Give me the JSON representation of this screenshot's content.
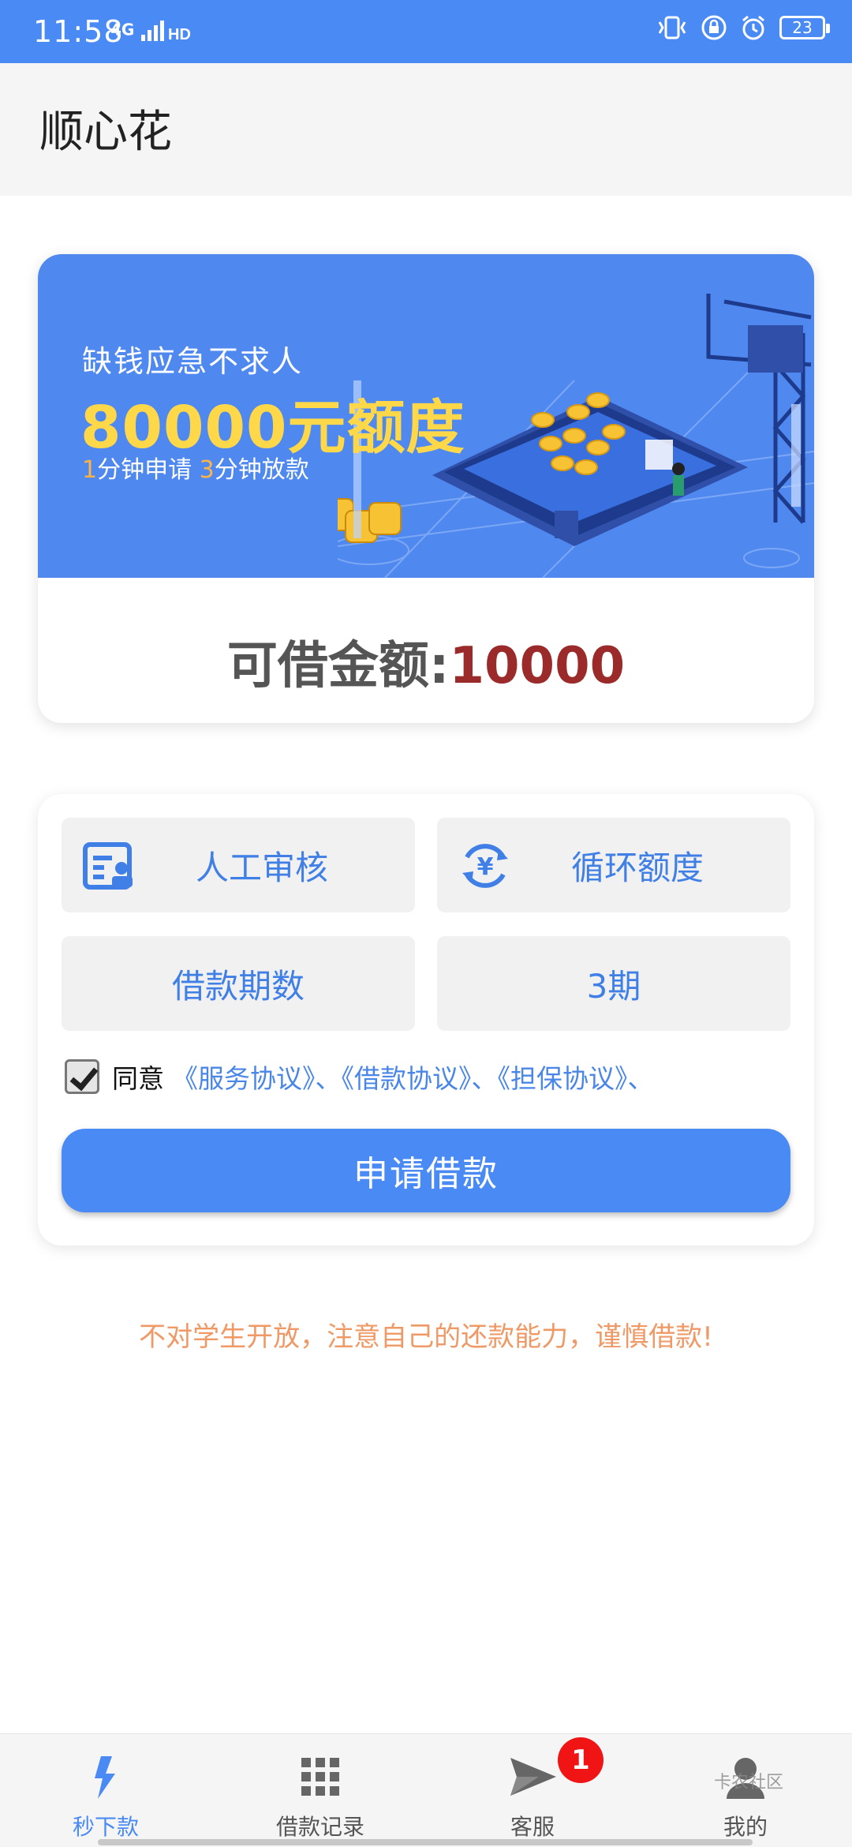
{
  "status_bar": {
    "time": "11:58",
    "network": "4G",
    "battery": "23"
  },
  "header": {
    "title": "顺心花"
  },
  "banner": {
    "slogan": "缺钱应急不求人",
    "headline": "80000元额度",
    "sub_num1": "1",
    "sub_text1": "分钟申请 ",
    "sub_num2": "3",
    "sub_text2": "分钟放款"
  },
  "amount": {
    "label": "可借金额:",
    "value": "10000"
  },
  "options": {
    "review": "人工审核",
    "quota": "循环额度",
    "term_label": "借款期数",
    "term_value": "3期"
  },
  "agreement": {
    "checked": true,
    "prefix": "同意",
    "links": "《服务协议》、《借款协议》、《担保协议》、"
  },
  "apply_button": "申请借款",
  "notice": "不对学生开放，注意自己的还款能力，谨慎借款!",
  "tabs": [
    {
      "label": "秒下款",
      "icon": "lightning-icon",
      "active": true
    },
    {
      "label": "借款记录",
      "icon": "grid-icon",
      "active": false
    },
    {
      "label": "客服",
      "icon": "send-icon",
      "active": false,
      "badge": "1"
    },
    {
      "label": "我的",
      "icon": "user-icon",
      "active": false
    }
  ],
  "watermark": "卡农社区",
  "colors": {
    "brand_blue": "#4a8af4",
    "amount_red": "#9b2a2a",
    "banner_yellow": "#ffd84a",
    "notice_orange": "#ef9a66",
    "badge_red": "#f01414"
  }
}
